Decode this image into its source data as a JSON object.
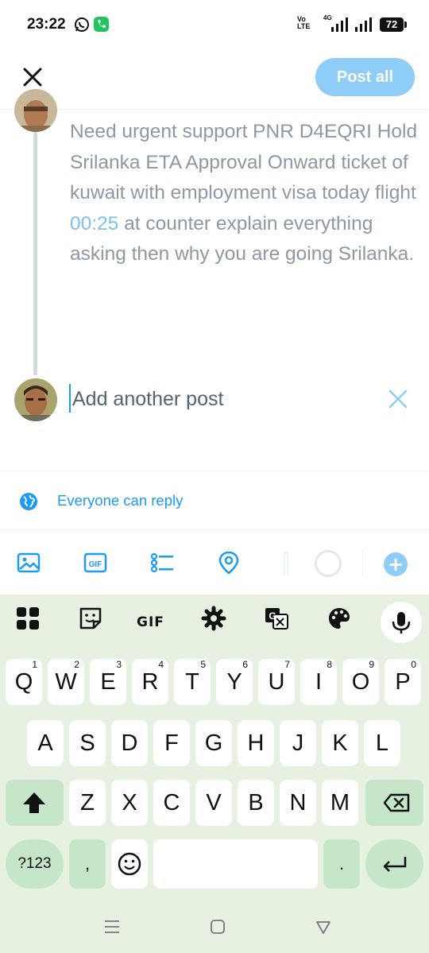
{
  "status_bar": {
    "time": "23:22",
    "network_label_1": "Vo",
    "network_label_2": "LTE",
    "network_type": "4G",
    "battery": "72"
  },
  "header": {
    "close_icon": "close-icon",
    "post_all_label": "Post all"
  },
  "thread": {
    "post_text_1": "Need urgent support PNR D4EQRI Hold Srilanka ETA Approval Onward ticket of kuwait with employment visa today flight ",
    "post_time_link": "00:25",
    "post_text_2": " at counter explain everything asking then why you are going Srilanka.",
    "add_post_placeholder": "Add another post"
  },
  "reply_setting": {
    "label": "Everyone can reply",
    "icon": "globe-icon"
  },
  "toolbar": {
    "icons": [
      "image-icon",
      "gif-icon",
      "poll-icon",
      "location-icon"
    ],
    "gif_label": "GIF",
    "add_label": "+"
  },
  "keyboard": {
    "gif_label": "GIF",
    "row1": [
      {
        "key": "Q",
        "hint": "1"
      },
      {
        "key": "W",
        "hint": "2"
      },
      {
        "key": "E",
        "hint": "3"
      },
      {
        "key": "R",
        "hint": "4"
      },
      {
        "key": "T",
        "hint": "5"
      },
      {
        "key": "Y",
        "hint": "6"
      },
      {
        "key": "U",
        "hint": "7"
      },
      {
        "key": "I",
        "hint": "8"
      },
      {
        "key": "O",
        "hint": "9"
      },
      {
        "key": "P",
        "hint": "0"
      }
    ],
    "row2": [
      "A",
      "S",
      "D",
      "F",
      "G",
      "H",
      "J",
      "K",
      "L"
    ],
    "row3": [
      "Z",
      "X",
      "C",
      "V",
      "B",
      "N",
      "M"
    ],
    "symbols_label": "?123",
    "comma_label": ",",
    "period_label": "."
  },
  "colors": {
    "accent": "#1d9bf0",
    "post_button": "#8ecdf7",
    "keyboard_bg": "#e6f1e1",
    "keyboard_special": "#c6e6c9"
  }
}
